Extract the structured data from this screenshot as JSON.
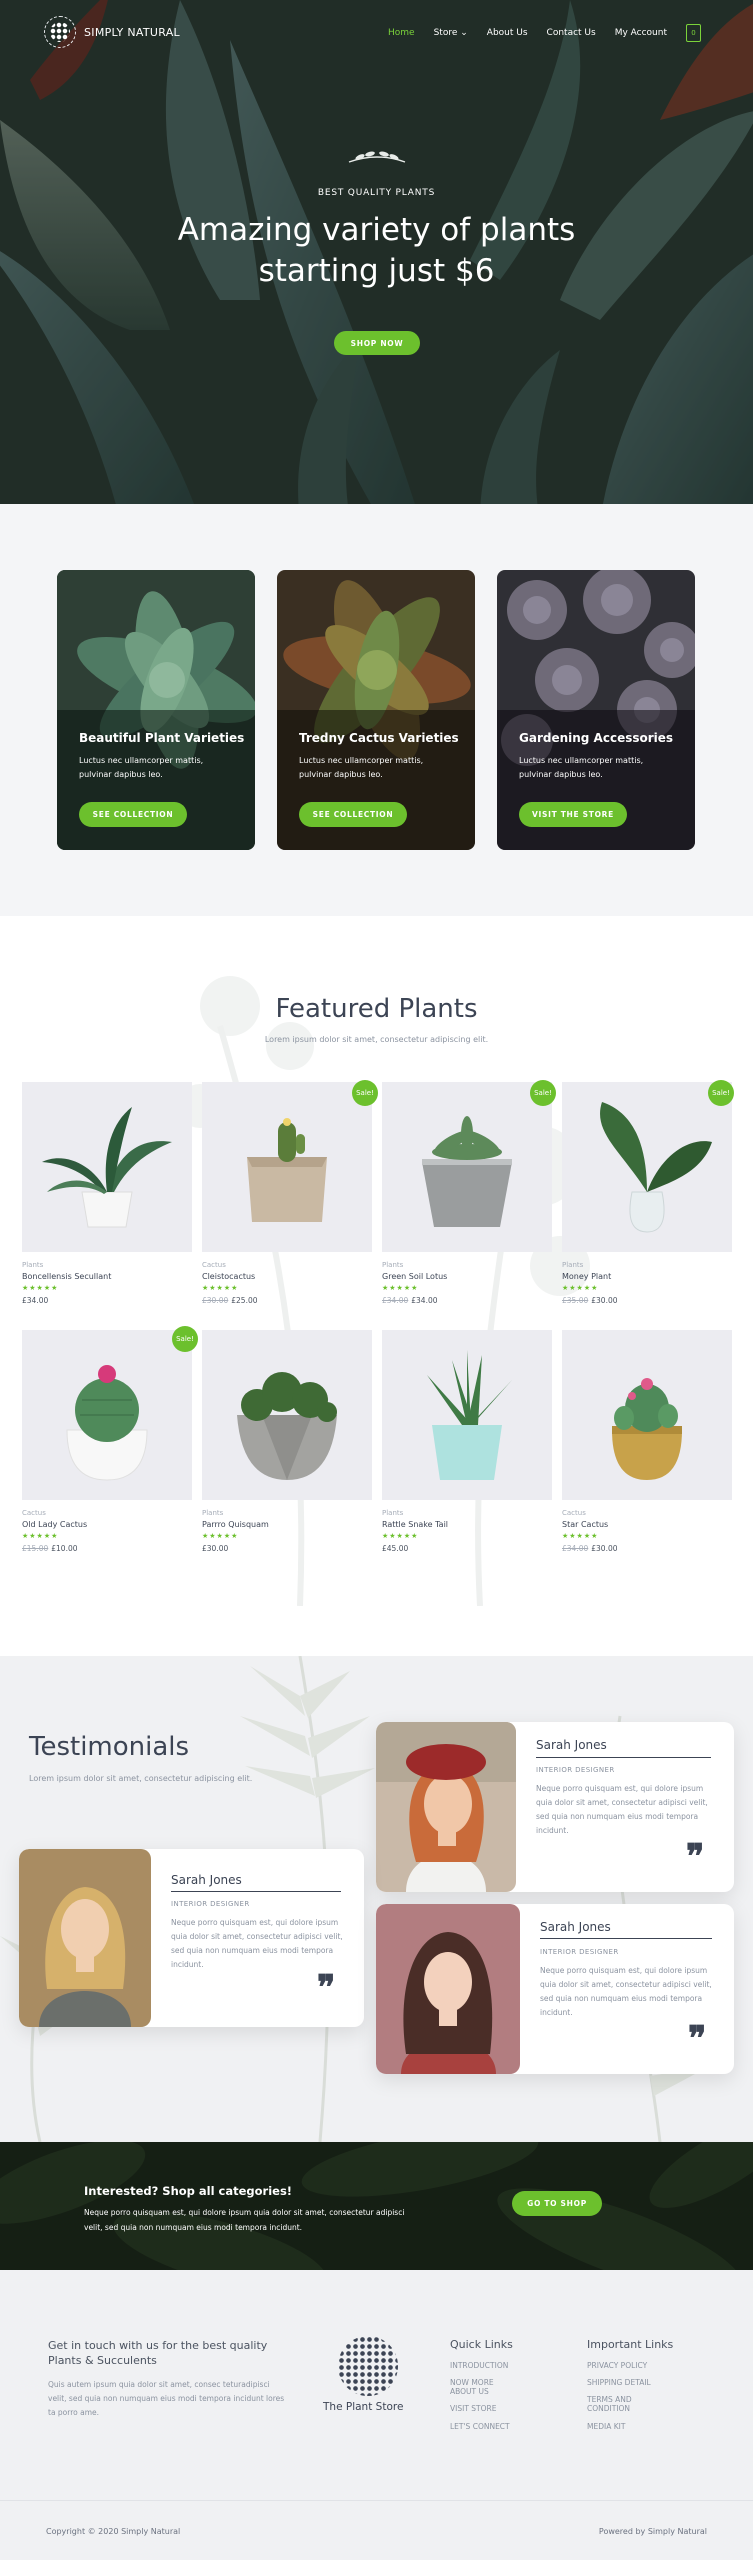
{
  "nav": {
    "brand": "SIMPLY NATURAL",
    "items": [
      {
        "label": "Home",
        "active": true
      },
      {
        "label": "Store",
        "dropdown": true
      },
      {
        "label": "About Us"
      },
      {
        "label": "Contact Us"
      },
      {
        "label": "My Account"
      }
    ],
    "cart_count": "0",
    "accent_color": "#7bd33a"
  },
  "hero": {
    "eyebrow": "BEST QUALITY PLANTS",
    "title_line1": "Amazing variety of plants",
    "title_line2": "starting just $6",
    "button": "SHOP NOW"
  },
  "categories": [
    {
      "title": "Beautiful Plant Varieties",
      "desc_line1": "Luctus nec ullamcorper mattis,",
      "desc_line2": "pulvinar dapibus leo.",
      "button": "SEE COLLECTION"
    },
    {
      "title": "Tredny Cactus Varieties",
      "desc_line1": "Luctus nec ullamcorper mattis,",
      "desc_line2": "pulvinar dapibus leo.",
      "button": "SEE COLLECTION"
    },
    {
      "title": "Gardening Accessories",
      "desc_line1": "Luctus nec ullamcorper mattis,",
      "desc_line2": "pulvinar dapibus leo.",
      "button": "VISIT THE STORE"
    }
  ],
  "featured": {
    "title": "Featured Plants",
    "subtitle": "Lorem ipsum dolor sit amet, consectetur adipiscing elit.",
    "sale_label": "Sale!",
    "stars": "★★★★★",
    "products": [
      {
        "category": "Plants",
        "name": "Boncellensis Secullant",
        "old_price": "",
        "price": "£34.00",
        "sale": false
      },
      {
        "category": "Cactus",
        "name": "Cleistocactus",
        "old_price": "£30.00",
        "price": "£25.00",
        "sale": true
      },
      {
        "category": "Plants",
        "name": "Green Soil Lotus",
        "old_price": "£34.00",
        "price": "£34.00",
        "sale": true
      },
      {
        "category": "Plants",
        "name": "Money Plant",
        "old_price": "£35.00",
        "price": "£30.00",
        "sale": true
      },
      {
        "category": "Cactus",
        "name": "Old Lady Cactus",
        "old_price": "£15.00",
        "price": "£10.00",
        "sale": true
      },
      {
        "category": "Plants",
        "name": "Parrro Quisquam",
        "old_price": "",
        "price": "£30.00",
        "sale": false
      },
      {
        "category": "Plants",
        "name": "Rattle Snake Tail",
        "old_price": "",
        "price": "£45.00",
        "sale": false
      },
      {
        "category": "Cactus",
        "name": "Star Cactus",
        "old_price": "£34.00",
        "price": "£30.00",
        "sale": false
      }
    ]
  },
  "testimonials": {
    "title": "Testimonials",
    "subtitle": "Lorem ipsum dolor sit amet, consectetur adipiscing elit.",
    "items": [
      {
        "name": "Sarah Jones",
        "role": "INTERIOR DESIGNER",
        "l1": "Neque porro quisquam est, qui dolore ipsum",
        "l2": "quia dolor sit amet, consectetur adipisci velit,",
        "l3": "sed quia non numquam eius modi tempora",
        "l4": "incidunt."
      },
      {
        "name": "Sarah Jones",
        "role": "INTERIOR DESIGNER",
        "l1": "Neque porro quisquam est, qui dolore ipsum",
        "l2": "quia dolor sit amet, consectetur adipisci velit,",
        "l3": "sed quia non numquam eius modi tempora",
        "l4": "incidunt."
      },
      {
        "name": "Sarah Jones",
        "role": "INTERIOR DESIGNER",
        "l1": "Neque porro quisquam est, qui dolore ipsum",
        "l2": "quia dolor sit amet, consectetur adipisci velit,",
        "l3": "sed quia non numquam eius modi tempora",
        "l4": "incidunt."
      }
    ]
  },
  "cta": {
    "title": "Interested? Shop all categories!",
    "line1": "Neque porro quisquam est, qui dolore ipsum quia dolor sit amet, consectetur adipisci",
    "line2": "velit, sed quia non numquam eius modi tempora incidunt.",
    "button": "GO TO SHOP"
  },
  "footer": {
    "about_title_l1": "Get in touch with us for the best quality",
    "about_title_l2": "Plants & Succulents",
    "about_l1": "Quis autem ipsum quia dolor sit amet, consec teturadipisci",
    "about_l2": "velit, sed quia non numquam eius modi tempora incidunt lores",
    "about_l3": "ta porro ame.",
    "store_name": "The Plant Store",
    "quick_title": "Quick Links",
    "quick_links": [
      "INTRODUCTION",
      "NOW MORE",
      "ABOUT US",
      "VISIT STORE",
      "LET'S CONNECT"
    ],
    "important_title": "Important Links",
    "important_links": [
      "PRIVACY POLICY",
      "SHIPPING DETAIL",
      "TERMS AND",
      "CONDITION",
      "MEDIA KIT"
    ],
    "copyright": "Copyright © 2020 Simply Natural",
    "powered": "Powered by Simply Natural"
  }
}
